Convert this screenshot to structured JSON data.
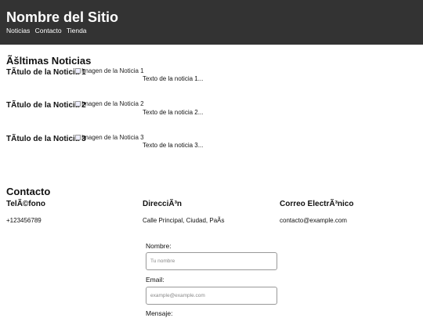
{
  "header": {
    "site_title": "Nombre del Sitio",
    "nav": [
      {
        "label": "Noticias"
      },
      {
        "label": "Contacto"
      },
      {
        "label": "Tienda"
      }
    ]
  },
  "news": {
    "heading": "Ãšltimas Noticias",
    "items": [
      {
        "title": "TÃ­tulo de la Noticia 1",
        "image_alt": "Imagen de la Noticia 1",
        "text": "Texto de la noticia 1..."
      },
      {
        "title": "TÃ­tulo de la Noticia 2",
        "image_alt": "Imagen de la Noticia 2",
        "text": "Texto de la noticia 2..."
      },
      {
        "title": "TÃ­tulo de la Noticia 3",
        "image_alt": "Imagen de la Noticia 3",
        "text": "Texto de la noticia 3..."
      }
    ]
  },
  "contact": {
    "heading": "Contacto",
    "phone_label": "TelÃ©fono",
    "phone_value": "+123456789",
    "address_label": "DirecciÃ³n",
    "address_value": "Calle Principal, Ciudad, PaÃ­s",
    "email_label": "Correo ElectrÃ³nico",
    "email_value": "contacto@example.com"
  },
  "form": {
    "name_label": "Nombre:",
    "name_placeholder": "Tu nombre",
    "email_label": "Email:",
    "email_placeholder": "example@example.com",
    "message_label": "Mensaje:"
  },
  "colors": {
    "header_bg": "#333333",
    "header_text": "#ffffff"
  }
}
